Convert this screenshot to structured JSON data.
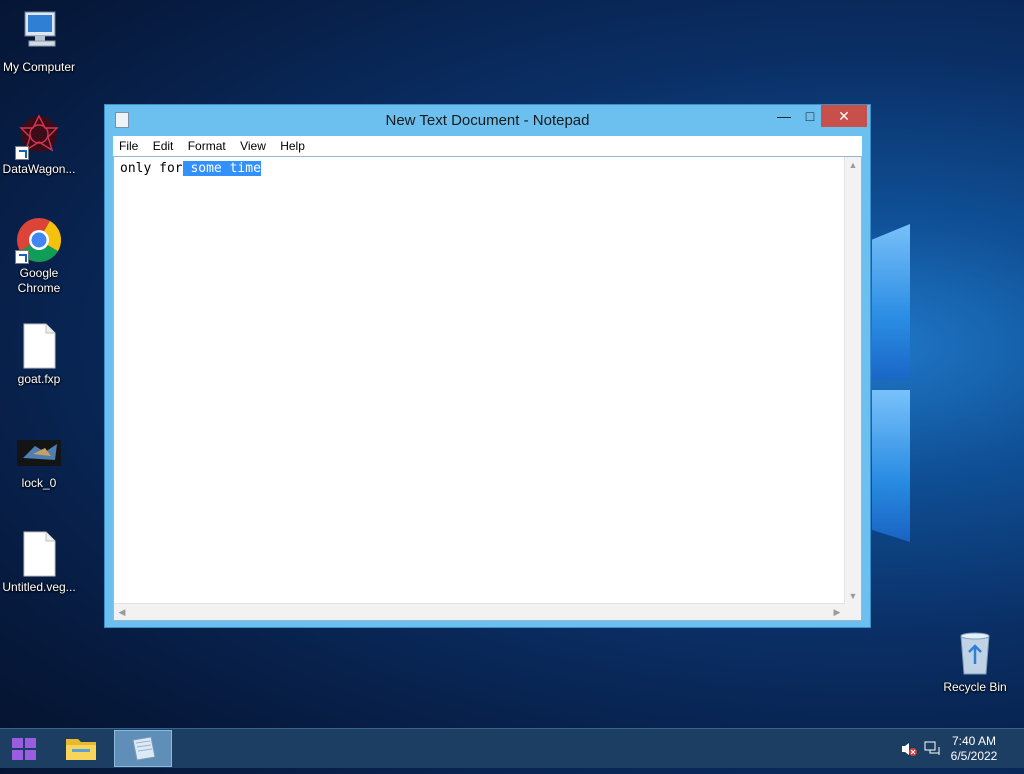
{
  "desktop": {
    "icons": [
      {
        "label": "My Computer",
        "icon": "computer-icon"
      },
      {
        "label": "DataWagon...",
        "icon": "datawagon-icon"
      },
      {
        "label": "Google Chrome",
        "icon": "chrome-icon"
      },
      {
        "label": "goat.fxp",
        "icon": "file-icon"
      },
      {
        "label": "lock_0",
        "icon": "lock-image-icon"
      },
      {
        "label": "Untitled.veg...",
        "icon": "file-icon"
      },
      {
        "label": "Recycle Bin",
        "icon": "recycle-bin-icon"
      }
    ]
  },
  "notepad": {
    "title": "New Text Document - Notepad",
    "menu": [
      "File",
      "Edit",
      "Format",
      "View",
      "Help"
    ],
    "text_unselected": "only for",
    "text_selected": " some time"
  },
  "taskbar": {
    "time": "7:40 AM",
    "date": "6/5/2022"
  },
  "colors": {
    "selection": "#3390ff",
    "titlebar": "#6cc0f0",
    "close_button": "#c7504a",
    "taskbar": "#1c3e63"
  }
}
